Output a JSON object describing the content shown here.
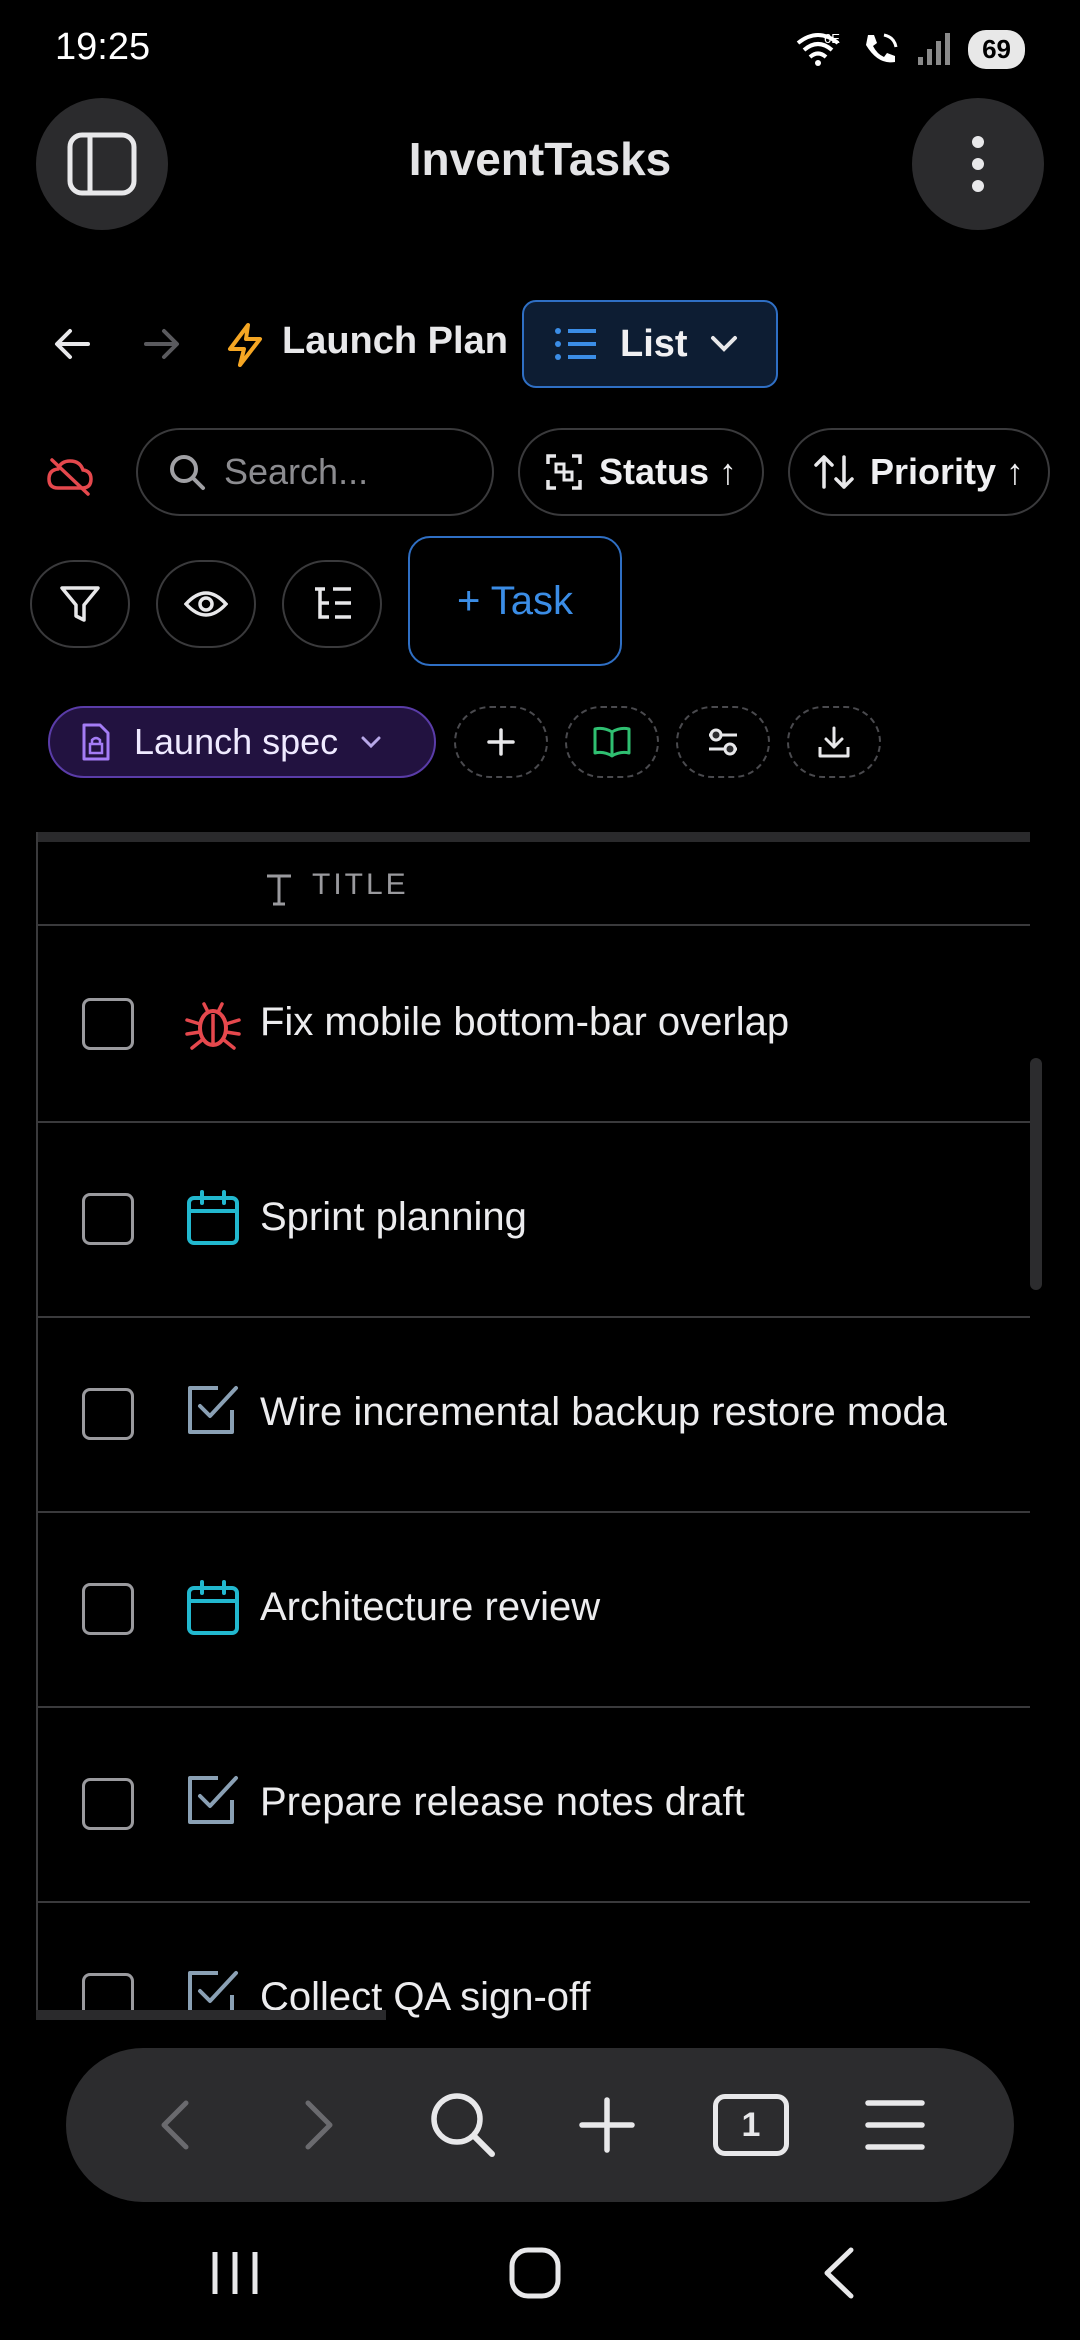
{
  "status_bar": {
    "time": "19:25",
    "battery": "69",
    "network": "6E"
  },
  "app": {
    "title": "InventTasks"
  },
  "breadcrumb": {
    "project": "Launch Plan",
    "view": "List"
  },
  "toolbar": {
    "search_placeholder": "Search...",
    "status_sort": "Status ↑",
    "priority_sort": "Priority ↑",
    "add_task": "+ Task"
  },
  "doc_chip": {
    "label": "Launch spec"
  },
  "table": {
    "column_title": "TITLE",
    "rows": [
      {
        "title": "Fix mobile bottom-bar overlap",
        "icon": "bug-icon",
        "color": "#e5484d"
      },
      {
        "title": "Sprint planning",
        "icon": "calendar-icon",
        "color": "#22b8cf"
      },
      {
        "title": "Wire incremental backup restore moda",
        "icon": "checkbox-task-icon",
        "color": "#8aa0b4"
      },
      {
        "title": "Architecture review",
        "icon": "calendar-icon",
        "color": "#22b8cf"
      },
      {
        "title": "Prepare release notes draft",
        "icon": "checkbox-task-icon",
        "color": "#8aa0b4"
      },
      {
        "title": "Collect QA sign-off",
        "icon": "checkbox-task-icon",
        "color": "#8aa0b4"
      }
    ]
  },
  "browser": {
    "tab_count": "1"
  },
  "colors": {
    "accent": "#3b8de6",
    "doc_chip": "#5a3ca8",
    "hidden_icon": "#e5484d",
    "bolt": "#f5a623"
  }
}
